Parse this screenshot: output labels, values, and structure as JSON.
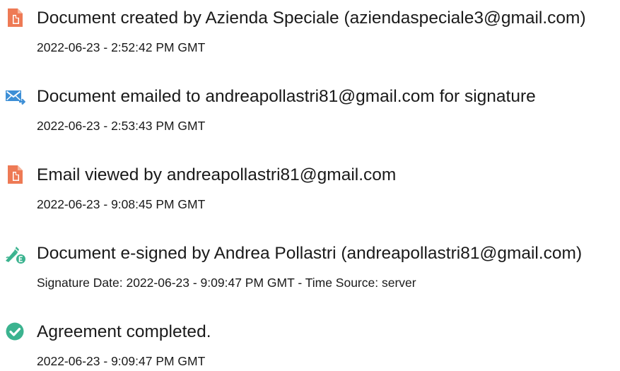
{
  "colors": {
    "document_icon": "#ee7a55",
    "email_icon": "#3d8fd6",
    "esign_icon": "#3bb38f",
    "check_icon": "#3bb38f",
    "text": "#1a1a1a"
  },
  "events": [
    {
      "icon": "document-icon",
      "title": "Document created by Azienda Speciale (aziendaspeciale3@gmail.com)",
      "detail": "2022-06-23 - 2:52:42 PM GMT"
    },
    {
      "icon": "email-icon",
      "title": "Document emailed to andreapollastri81@gmail.com for signature",
      "detail": "2022-06-23 - 2:53:43 PM GMT"
    },
    {
      "icon": "document-icon",
      "title": "Email viewed by andreapollastri81@gmail.com",
      "detail": "2022-06-23 - 9:08:45 PM GMT"
    },
    {
      "icon": "esign-pen-icon",
      "title": "Document e-signed by Andrea Pollastri (andreapollastri81@gmail.com)",
      "detail": "Signature Date: 2022-06-23 - 9:09:47 PM GMT - Time Source: server"
    },
    {
      "icon": "checkmark-circle-icon",
      "title": "Agreement completed.",
      "detail": "2022-06-23 - 9:09:47 PM GMT"
    }
  ]
}
